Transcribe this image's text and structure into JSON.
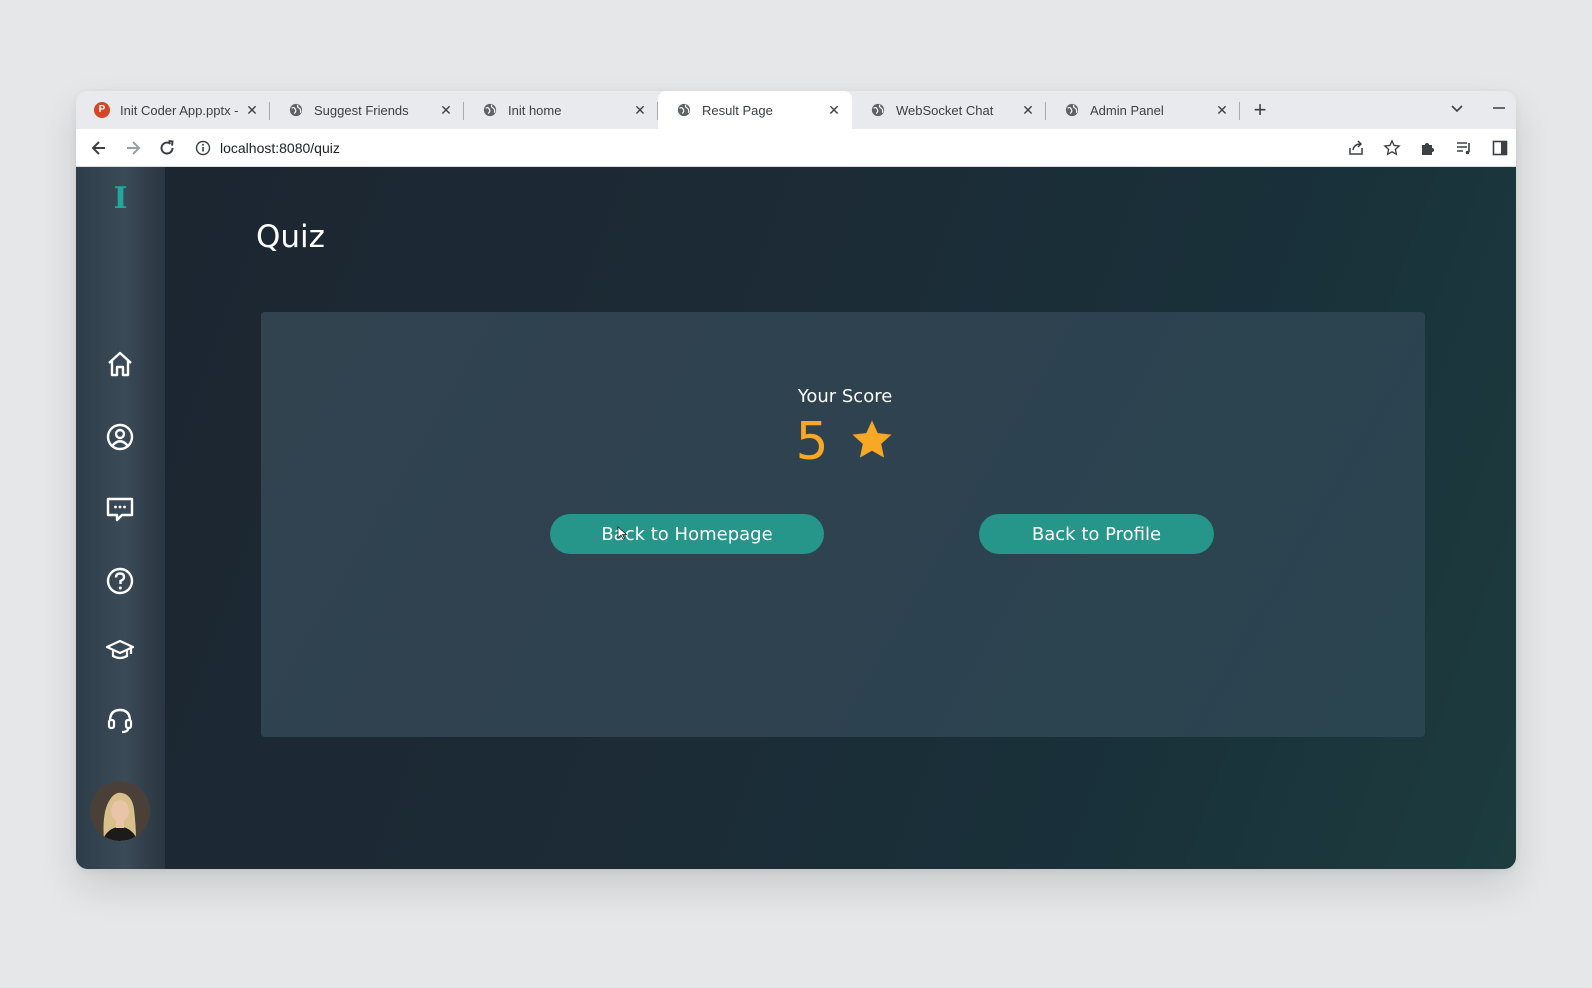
{
  "browser": {
    "tabs": [
      {
        "title": "Init Coder App.pptx -",
        "icon": "powerpoint-icon",
        "active": false
      },
      {
        "title": "Suggest Friends",
        "icon": "globe-icon",
        "active": false
      },
      {
        "title": "Init home",
        "icon": "globe-icon",
        "active": false
      },
      {
        "title": "Result Page",
        "icon": "globe-icon",
        "active": true
      },
      {
        "title": "WebSocket Chat",
        "icon": "globe-icon",
        "active": false
      },
      {
        "title": "Admin Panel",
        "icon": "globe-icon",
        "active": false
      }
    ],
    "new_tab": "+",
    "address": "localhost:8080/quiz"
  },
  "app": {
    "logo": "I",
    "nav": [
      "home-icon",
      "profile-icon",
      "chat-icon",
      "help-icon",
      "graduation-cap-icon",
      "support-headset-icon"
    ],
    "page_title": "Quiz",
    "score_label": "Your Score",
    "score_value": "5",
    "buttons": {
      "home": "Back to Homepage",
      "profile": "Back to Profile"
    }
  },
  "colors": {
    "accent": "#26958a",
    "logo": "#21a89a",
    "score": "#f9a825"
  }
}
